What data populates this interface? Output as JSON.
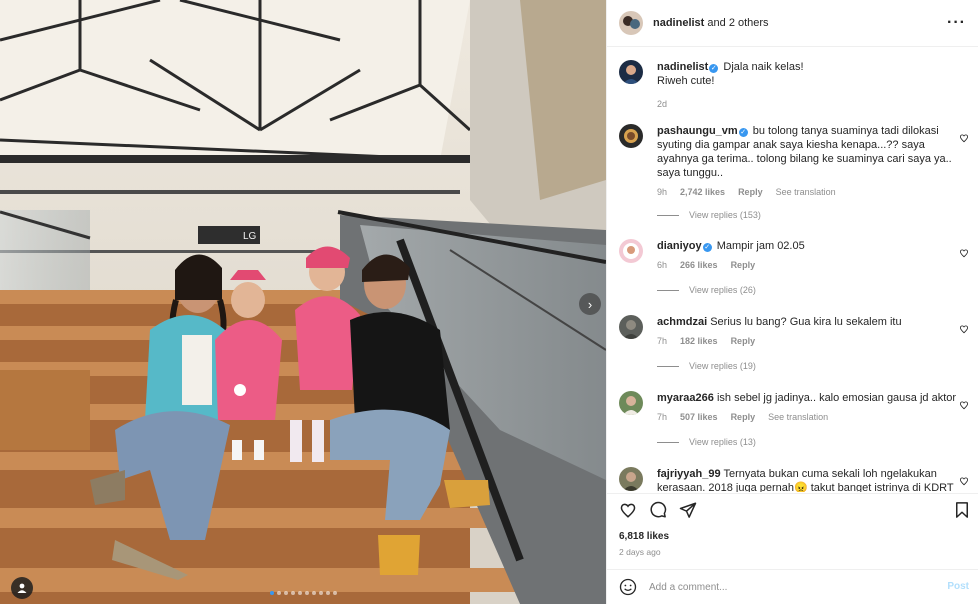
{
  "post": {
    "author": "nadinelist",
    "coauthors": "and 2 others",
    "caption_user": "nadinelist",
    "caption_line1": "Djala naik kelas!",
    "caption_line2": "Riweh cute!",
    "caption_time": "2d",
    "likes": "6,818 likes",
    "posted": "2 days ago",
    "carousel_count": 10,
    "carousel_active": 0
  },
  "signage": {
    "level": "LG"
  },
  "comments": [
    {
      "user": "pashaungu_vm",
      "verified": true,
      "text": "bu tolong tanya suaminya tadi dilokasi syuting dia gampar anak saya kiesha kenapa...?? saya ayahnya ga terima.. tolong bilang ke suaminya cari saya ya.. saya tunggu..",
      "time": "9h",
      "likes": "2,742 likes",
      "reply": "Reply",
      "translate": "See translation",
      "replies": "View replies (153)"
    },
    {
      "user": "dianiyoy",
      "verified": true,
      "text": "Mampir jam 02.05",
      "time": "6h",
      "likes": "266 likes",
      "reply": "Reply",
      "replies": "View replies (26)"
    },
    {
      "user": "achmdzai",
      "verified": false,
      "text": "Serius lu bang? Gua kira lu sekalem itu",
      "time": "7h",
      "likes": "182 likes",
      "reply": "Reply",
      "replies": "View replies (19)"
    },
    {
      "user": "myaraa266",
      "verified": false,
      "text": "ish sebel jg jadinya.. kalo emosian gausa jd aktor",
      "time": "7h",
      "likes": "507 likes",
      "reply": "Reply",
      "translate": "See translation",
      "replies": "View replies (13)"
    },
    {
      "user": "fajriyyah_99",
      "verified": false,
      "text": "Ternyata bukan cuma sekali loh ngelakukan kerasaan. 2018 juga pernah😠 takut banget istrinya di KDRT😭"
    }
  ],
  "add_comment": {
    "placeholder": "Add a comment...",
    "post_label": "Post"
  },
  "icons": {
    "more": "more-options-icon",
    "heart": "heart-icon",
    "comment": "comment-icon",
    "share": "share-icon",
    "save": "bookmark-icon",
    "emoji": "emoji-icon",
    "next": "chevron-right-icon",
    "tag": "user-tag-icon"
  },
  "colors": {
    "accent": "#3897f0",
    "muted": "#8e8e8e",
    "text": "#262626",
    "border": "#efefef",
    "post_disabled": "#b2dffc"
  }
}
